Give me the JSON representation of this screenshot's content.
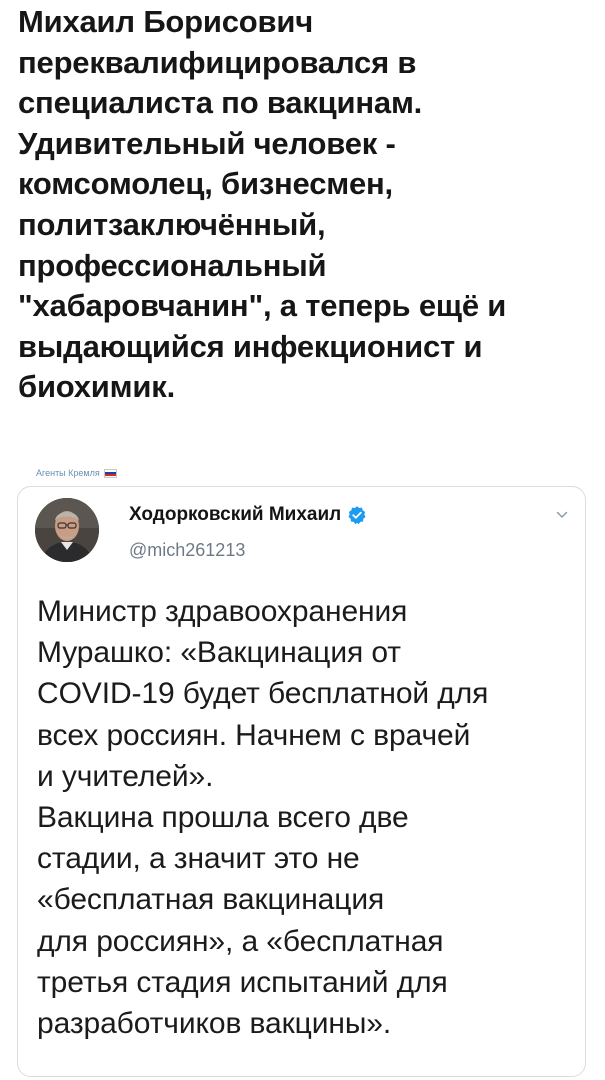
{
  "post": {
    "lines": [
      "Михаил Борисович",
      "переквалифицировался в",
      "специалиста по вакцинам.",
      "Удивительный человек -",
      "комсомолец, бизнесмен,",
      "политзаключённый,",
      "профессиональный",
      "\"хабаровчанин\", а теперь ещё и",
      "выдающийся инфекционист и",
      "биохимик."
    ]
  },
  "watermark": {
    "text": "Агенты Кремля",
    "flag_colors": [
      "#ffffff",
      "#1c3fa8",
      "#d52b1e"
    ]
  },
  "tweet": {
    "author_name": "Ходорковский Михаил",
    "handle": "@mich261213",
    "verified_color": "#1d9bf0",
    "icons": {
      "verified": "verified-badge-icon",
      "menu": "chevron-down-icon"
    },
    "lines": [
      "Министр здравоохранения",
      "Мурашко: «Вакцинация от",
      "COVID-19 будет бесплатной для",
      "всех россиян. Начнем с врачей",
      "и учителей».",
      "Вакцина прошла всего две",
      "стадии, а значит это не",
      "«бесплатная вакцинация",
      "для россиян», а «бесплатная",
      "третья стадия испытаний для",
      "разработчиков вакцины»."
    ]
  }
}
